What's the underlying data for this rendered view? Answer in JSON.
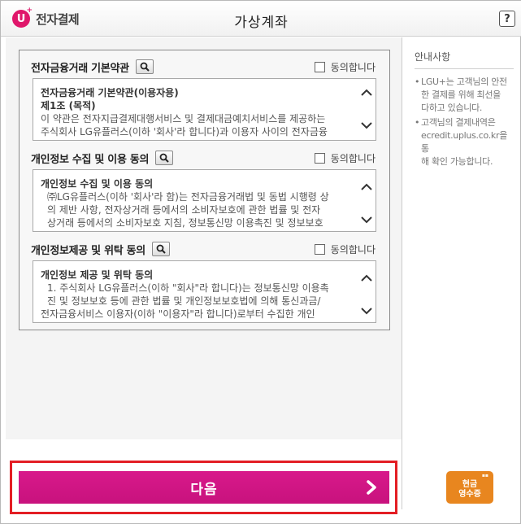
{
  "header": {
    "logo_mark": "U",
    "logo_text": "전자결제",
    "title": "가상계좌",
    "help_label": "?"
  },
  "sections": [
    {
      "title": "전자금융거래 기본약관",
      "agree_label": "동의합니다",
      "heading": "전자금융거래 기본약관(이용자용)",
      "subheading": "제1조 (목적)",
      "lines": [
        "이 약관은 전자지급결제대행서비스 및 결제대금예치서비스를 제공하는",
        "주식회사 LG유플러스(이하 '회사'라 합니다)과 이용자 사이의 전자금융"
      ]
    },
    {
      "title": "개인정보 수집 및 이용 동의",
      "agree_label": "동의합니다",
      "heading": "개인정보 수집 및 이용 동의",
      "lines": [
        "㈜LG유플러스(이하 '회사'라 함)는 전자금융거래법 및 동법 시행령 상",
        "의 제반 사항, 전자상거래 등에서의 소비자보호에 관한 법률 및 전자",
        "상거래 등에서의 소비자보호 지침, 정보통신망 이용촉진 및 정보보호"
      ]
    },
    {
      "title": "개인정보제공 및 위탁 동의",
      "agree_label": "동의합니다",
      "heading": "개인정보 제공 및 위탁 동의",
      "lines": [
        "1. 주식회사 LG유플러스(이하 \"회사\"라 합니다)는 정보통신망 이용촉",
        "진 및 정보보호 등에 관한 법률 및 개인정보보호법에 의해 통신과금/",
        "전자금융서비스 이용자(이하 \"이용자\"라 합니다)로부터 수집한 개인"
      ]
    }
  ],
  "info": {
    "title": "안내사항",
    "items": [
      [
        "LGU+는 고객님의 안전",
        "한 결제를 위해 최선을",
        "다하고 있습니다."
      ],
      [
        "고객님의 결제내역은",
        "ecredit.uplus.co.kr을 통",
        "해 확인 가능합니다."
      ]
    ]
  },
  "receipt": {
    "line1": "현금",
    "line2": "영수증"
  },
  "next_button": {
    "label": "다음"
  },
  "colors": {
    "brand": "#e0176b",
    "next": "#d0158a",
    "highlight": "#e31e24",
    "receipt": "#e8861f"
  }
}
